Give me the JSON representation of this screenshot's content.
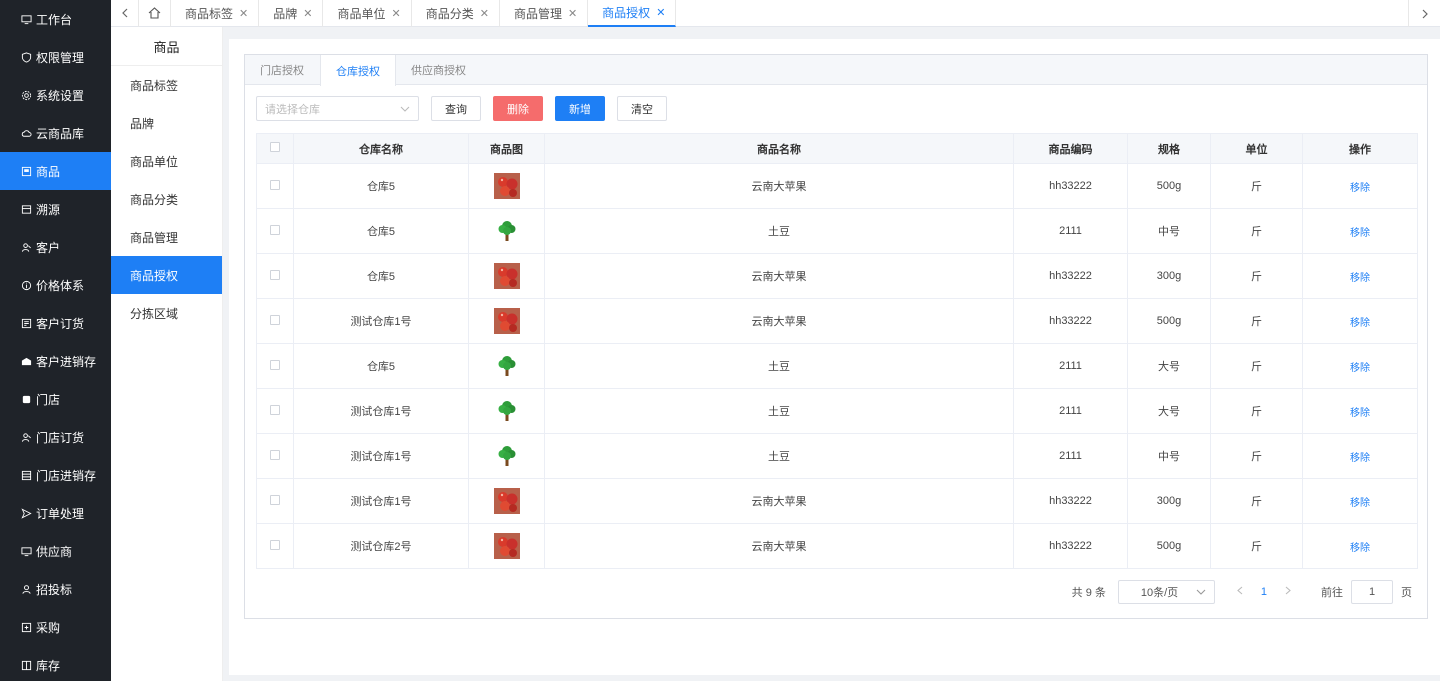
{
  "sidebar": {
    "items": [
      {
        "label": "工作台",
        "icon": "monitor-icon"
      },
      {
        "label": "权限管理",
        "icon": "shield-icon"
      },
      {
        "label": "系统设置",
        "icon": "gear-icon"
      },
      {
        "label": "云商品库",
        "icon": "cloud-icon"
      },
      {
        "label": "商品",
        "icon": "goods-icon",
        "active": true
      },
      {
        "label": "溯源",
        "icon": "trace-icon"
      },
      {
        "label": "客户",
        "icon": "user-icon"
      },
      {
        "label": "价格体系",
        "icon": "info-icon"
      },
      {
        "label": "客户订货",
        "icon": "order-icon"
      },
      {
        "label": "客户进销存",
        "icon": "warehouse-icon"
      },
      {
        "label": "门店",
        "icon": "store-icon"
      },
      {
        "label": "门店订货",
        "icon": "user-icon"
      },
      {
        "label": "门店进销存",
        "icon": "list-icon"
      },
      {
        "label": "订单处理",
        "icon": "send-icon"
      },
      {
        "label": "供应商",
        "icon": "monitor-icon"
      },
      {
        "label": "招投标",
        "icon": "person-icon"
      },
      {
        "label": "采购",
        "icon": "cart-icon"
      },
      {
        "label": "库存",
        "icon": "box-icon"
      }
    ]
  },
  "topbar": {
    "tabs": [
      {
        "label": "商品标签"
      },
      {
        "label": "品牌"
      },
      {
        "label": "商品单位"
      },
      {
        "label": "商品分类"
      },
      {
        "label": "商品管理"
      },
      {
        "label": "商品授权",
        "active": true
      }
    ]
  },
  "submenu": {
    "title": "商品",
    "items": [
      {
        "label": "商品标签"
      },
      {
        "label": "品牌"
      },
      {
        "label": "商品单位"
      },
      {
        "label": "商品分类"
      },
      {
        "label": "商品管理"
      },
      {
        "label": "商品授权",
        "active": true
      },
      {
        "label": "分拣区域"
      }
    ]
  },
  "card": {
    "tabs": [
      {
        "label": "门店授权"
      },
      {
        "label": "仓库授权",
        "active": true
      },
      {
        "label": "供应商授权"
      }
    ]
  },
  "toolbar": {
    "select_placeholder": "请选择仓库",
    "query_label": "查询",
    "delete_label": "删除",
    "add_label": "新增",
    "clear_label": "清空"
  },
  "table": {
    "headers": [
      "仓库名称",
      "商品图",
      "商品名称",
      "商品编码",
      "规格",
      "单位",
      "操作"
    ],
    "rows": [
      {
        "warehouse": "仓库5",
        "img": "apple",
        "name": "云南大苹果",
        "code": "hh33222",
        "spec": "500g",
        "unit": "斤",
        "action": "移除"
      },
      {
        "warehouse": "仓库5",
        "img": "tree",
        "name": "土豆",
        "code": "2111",
        "spec": "中号",
        "unit": "斤",
        "action": "移除"
      },
      {
        "warehouse": "仓库5",
        "img": "apple",
        "name": "云南大苹果",
        "code": "hh33222",
        "spec": "300g",
        "unit": "斤",
        "action": "移除"
      },
      {
        "warehouse": "测试仓库1号",
        "img": "apple",
        "name": "云南大苹果",
        "code": "hh33222",
        "spec": "500g",
        "unit": "斤",
        "action": "移除"
      },
      {
        "warehouse": "仓库5",
        "img": "tree",
        "name": "土豆",
        "code": "2111",
        "spec": "大号",
        "unit": "斤",
        "action": "移除"
      },
      {
        "warehouse": "测试仓库1号",
        "img": "tree",
        "name": "土豆",
        "code": "2111",
        "spec": "大号",
        "unit": "斤",
        "action": "移除"
      },
      {
        "warehouse": "测试仓库1号",
        "img": "tree",
        "name": "土豆",
        "code": "2111",
        "spec": "中号",
        "unit": "斤",
        "action": "移除"
      },
      {
        "warehouse": "测试仓库1号",
        "img": "apple",
        "name": "云南大苹果",
        "code": "hh33222",
        "spec": "300g",
        "unit": "斤",
        "action": "移除"
      },
      {
        "warehouse": "测试仓库2号",
        "img": "apple",
        "name": "云南大苹果",
        "code": "hh33222",
        "spec": "500g",
        "unit": "斤",
        "action": "移除"
      }
    ]
  },
  "pager": {
    "total": "共 9 条",
    "page_size": "10条/页",
    "current": "1",
    "goto_label": "前往",
    "goto_value": "1",
    "unit": "页"
  },
  "colors": {
    "accent": "#1e7ff5",
    "danger": "#f56c6c",
    "sidebar_bg": "#1f2329"
  }
}
